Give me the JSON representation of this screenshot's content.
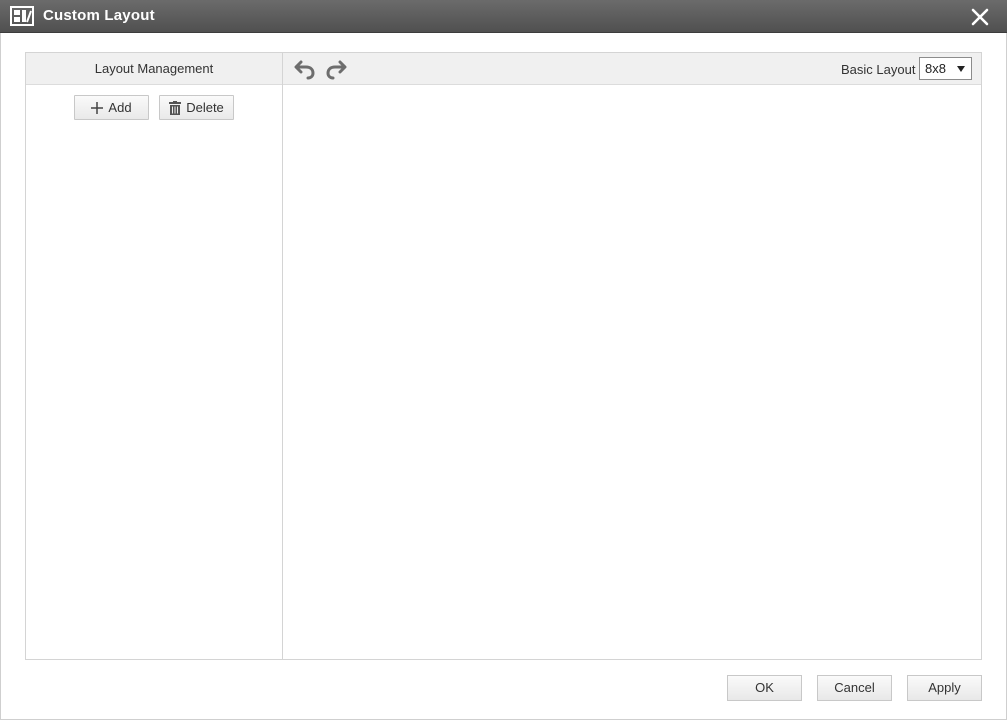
{
  "window": {
    "title": "Custom Layout",
    "icon": "layout-grid-icon",
    "close_icon": "close-icon"
  },
  "layout_management": {
    "header": "Layout Management",
    "add_label": "Add",
    "delete_label": "Delete"
  },
  "editor": {
    "undo_icon": "undo-icon",
    "redo_icon": "redo-icon",
    "basic_layout_label": "Basic Layout",
    "basic_layout_value": "8x8"
  },
  "footer": {
    "ok_label": "OK",
    "cancel_label": "Cancel",
    "apply_label": "Apply"
  },
  "colors": {
    "titlebar": "#5a5a5a",
    "header_bg": "#f0f0f0",
    "border": "#d4d4d4"
  }
}
